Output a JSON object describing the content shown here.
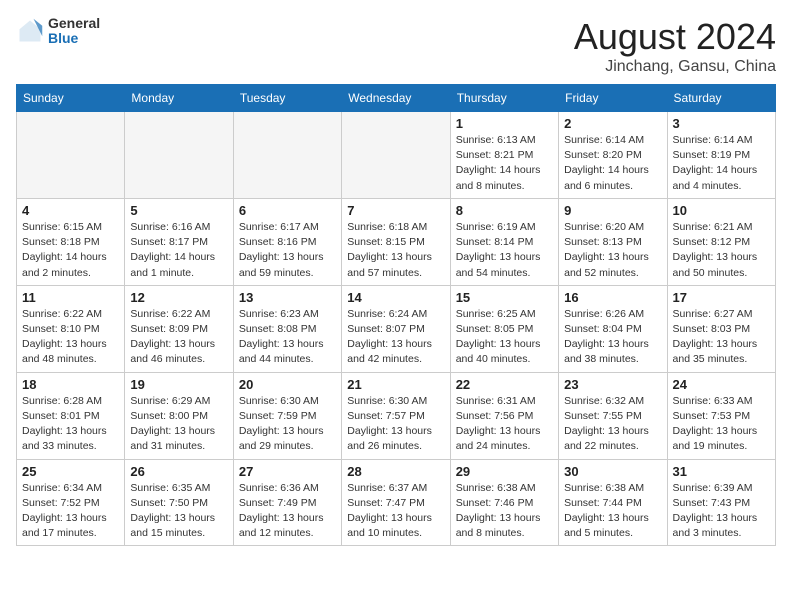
{
  "header": {
    "logo_general": "General",
    "logo_blue": "Blue",
    "month_title": "August 2024",
    "location": "Jinchang, Gansu, China"
  },
  "days_of_week": [
    "Sunday",
    "Monday",
    "Tuesday",
    "Wednesday",
    "Thursday",
    "Friday",
    "Saturday"
  ],
  "weeks": [
    [
      {
        "day": "",
        "info": ""
      },
      {
        "day": "",
        "info": ""
      },
      {
        "day": "",
        "info": ""
      },
      {
        "day": "",
        "info": ""
      },
      {
        "day": "1",
        "info": "Sunrise: 6:13 AM\nSunset: 8:21 PM\nDaylight: 14 hours\nand 8 minutes."
      },
      {
        "day": "2",
        "info": "Sunrise: 6:14 AM\nSunset: 8:20 PM\nDaylight: 14 hours\nand 6 minutes."
      },
      {
        "day": "3",
        "info": "Sunrise: 6:14 AM\nSunset: 8:19 PM\nDaylight: 14 hours\nand 4 minutes."
      }
    ],
    [
      {
        "day": "4",
        "info": "Sunrise: 6:15 AM\nSunset: 8:18 PM\nDaylight: 14 hours\nand 2 minutes."
      },
      {
        "day": "5",
        "info": "Sunrise: 6:16 AM\nSunset: 8:17 PM\nDaylight: 14 hours\nand 1 minute."
      },
      {
        "day": "6",
        "info": "Sunrise: 6:17 AM\nSunset: 8:16 PM\nDaylight: 13 hours\nand 59 minutes."
      },
      {
        "day": "7",
        "info": "Sunrise: 6:18 AM\nSunset: 8:15 PM\nDaylight: 13 hours\nand 57 minutes."
      },
      {
        "day": "8",
        "info": "Sunrise: 6:19 AM\nSunset: 8:14 PM\nDaylight: 13 hours\nand 54 minutes."
      },
      {
        "day": "9",
        "info": "Sunrise: 6:20 AM\nSunset: 8:13 PM\nDaylight: 13 hours\nand 52 minutes."
      },
      {
        "day": "10",
        "info": "Sunrise: 6:21 AM\nSunset: 8:12 PM\nDaylight: 13 hours\nand 50 minutes."
      }
    ],
    [
      {
        "day": "11",
        "info": "Sunrise: 6:22 AM\nSunset: 8:10 PM\nDaylight: 13 hours\nand 48 minutes."
      },
      {
        "day": "12",
        "info": "Sunrise: 6:22 AM\nSunset: 8:09 PM\nDaylight: 13 hours\nand 46 minutes."
      },
      {
        "day": "13",
        "info": "Sunrise: 6:23 AM\nSunset: 8:08 PM\nDaylight: 13 hours\nand 44 minutes."
      },
      {
        "day": "14",
        "info": "Sunrise: 6:24 AM\nSunset: 8:07 PM\nDaylight: 13 hours\nand 42 minutes."
      },
      {
        "day": "15",
        "info": "Sunrise: 6:25 AM\nSunset: 8:05 PM\nDaylight: 13 hours\nand 40 minutes."
      },
      {
        "day": "16",
        "info": "Sunrise: 6:26 AM\nSunset: 8:04 PM\nDaylight: 13 hours\nand 38 minutes."
      },
      {
        "day": "17",
        "info": "Sunrise: 6:27 AM\nSunset: 8:03 PM\nDaylight: 13 hours\nand 35 minutes."
      }
    ],
    [
      {
        "day": "18",
        "info": "Sunrise: 6:28 AM\nSunset: 8:01 PM\nDaylight: 13 hours\nand 33 minutes."
      },
      {
        "day": "19",
        "info": "Sunrise: 6:29 AM\nSunset: 8:00 PM\nDaylight: 13 hours\nand 31 minutes."
      },
      {
        "day": "20",
        "info": "Sunrise: 6:30 AM\nSunset: 7:59 PM\nDaylight: 13 hours\nand 29 minutes."
      },
      {
        "day": "21",
        "info": "Sunrise: 6:30 AM\nSunset: 7:57 PM\nDaylight: 13 hours\nand 26 minutes."
      },
      {
        "day": "22",
        "info": "Sunrise: 6:31 AM\nSunset: 7:56 PM\nDaylight: 13 hours\nand 24 minutes."
      },
      {
        "day": "23",
        "info": "Sunrise: 6:32 AM\nSunset: 7:55 PM\nDaylight: 13 hours\nand 22 minutes."
      },
      {
        "day": "24",
        "info": "Sunrise: 6:33 AM\nSunset: 7:53 PM\nDaylight: 13 hours\nand 19 minutes."
      }
    ],
    [
      {
        "day": "25",
        "info": "Sunrise: 6:34 AM\nSunset: 7:52 PM\nDaylight: 13 hours\nand 17 minutes."
      },
      {
        "day": "26",
        "info": "Sunrise: 6:35 AM\nSunset: 7:50 PM\nDaylight: 13 hours\nand 15 minutes."
      },
      {
        "day": "27",
        "info": "Sunrise: 6:36 AM\nSunset: 7:49 PM\nDaylight: 13 hours\nand 12 minutes."
      },
      {
        "day": "28",
        "info": "Sunrise: 6:37 AM\nSunset: 7:47 PM\nDaylight: 13 hours\nand 10 minutes."
      },
      {
        "day": "29",
        "info": "Sunrise: 6:38 AM\nSunset: 7:46 PM\nDaylight: 13 hours\nand 8 minutes."
      },
      {
        "day": "30",
        "info": "Sunrise: 6:38 AM\nSunset: 7:44 PM\nDaylight: 13 hours\nand 5 minutes."
      },
      {
        "day": "31",
        "info": "Sunrise: 6:39 AM\nSunset: 7:43 PM\nDaylight: 13 hours\nand 3 minutes."
      }
    ]
  ]
}
